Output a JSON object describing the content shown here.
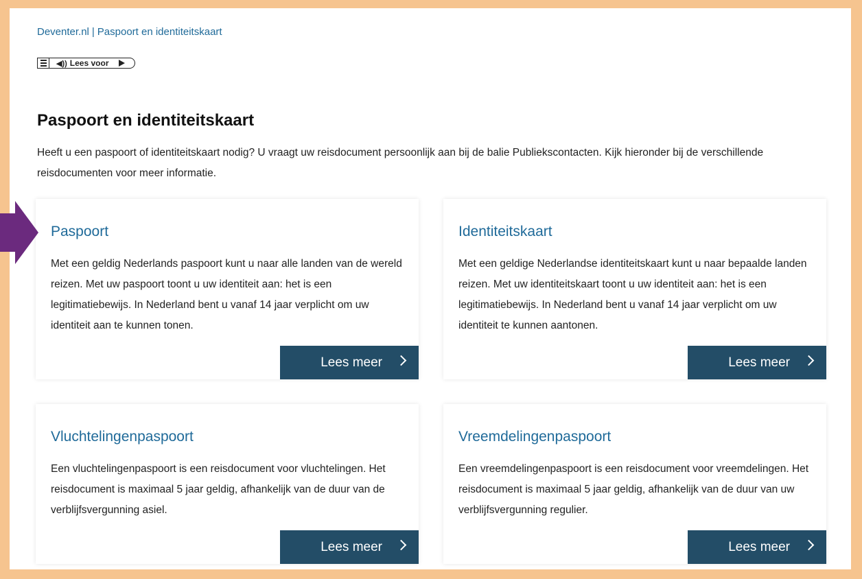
{
  "breadcrumb": {
    "home": "Deventer.nl",
    "separator": "|",
    "current": "Paspoort en identiteitskaart"
  },
  "readspeaker": {
    "label": "Lees voor",
    "menu_icon": "hamburger-icon",
    "speaker_icon": "speaker-icon",
    "play_icon": "play-icon"
  },
  "page": {
    "title": "Paspoort en identiteitskaart",
    "intro": "Heeft u een paspoort of identiteitskaart nodig? U vraagt uw reisdocument persoonlijk aan bij de balie Publiekscontacten. Kijk hieronder bij de verschillende reisdocumenten voor meer informatie."
  },
  "cards": [
    {
      "title": "Paspoort",
      "text": "Met een geldig Nederlands paspoort kunt u naar alle landen van de wereld reizen. Met uw paspoort toont u uw identiteit aan: het is een legitimatiebewijs. In Nederland bent u vanaf 14 jaar verplicht om uw identiteit aan te kunnen tonen.",
      "button": "Lees meer"
    },
    {
      "title": "Identiteitskaart",
      "text": "Met een geldige Nederlandse identiteitskaart kunt u naar bepaalde landen reizen. Met uw identiteitskaart toont u uw identiteit aan: het is een legitimatiebewijs. In Nederland bent u vanaf 14 jaar verplicht om uw identiteit te kunnen aantonen.",
      "button": "Lees meer"
    },
    {
      "title": "Vluchtelingenpaspoort",
      "text": "Een vluchtelingenpaspoort is een reisdocument voor vluchtelingen. Het reisdocument is maximaal 5 jaar geldig, afhankelijk van de duur van de verblijfsvergunning asiel.",
      "button": "Lees meer"
    },
    {
      "title": "Vreemdelingenpaspoort",
      "text": "Een vreemdelingenpaspoort is een reisdocument voor vreemdelingen. Het reisdocument is maximaal 5 jaar geldig, afhankelijk van de duur van uw verblijfsvergunning regulier.",
      "button": "Lees meer"
    }
  ],
  "colors": {
    "frame": "#f6c48f",
    "link": "#1f6a99",
    "button": "#234d67",
    "arrow": "#6b2a7e"
  }
}
